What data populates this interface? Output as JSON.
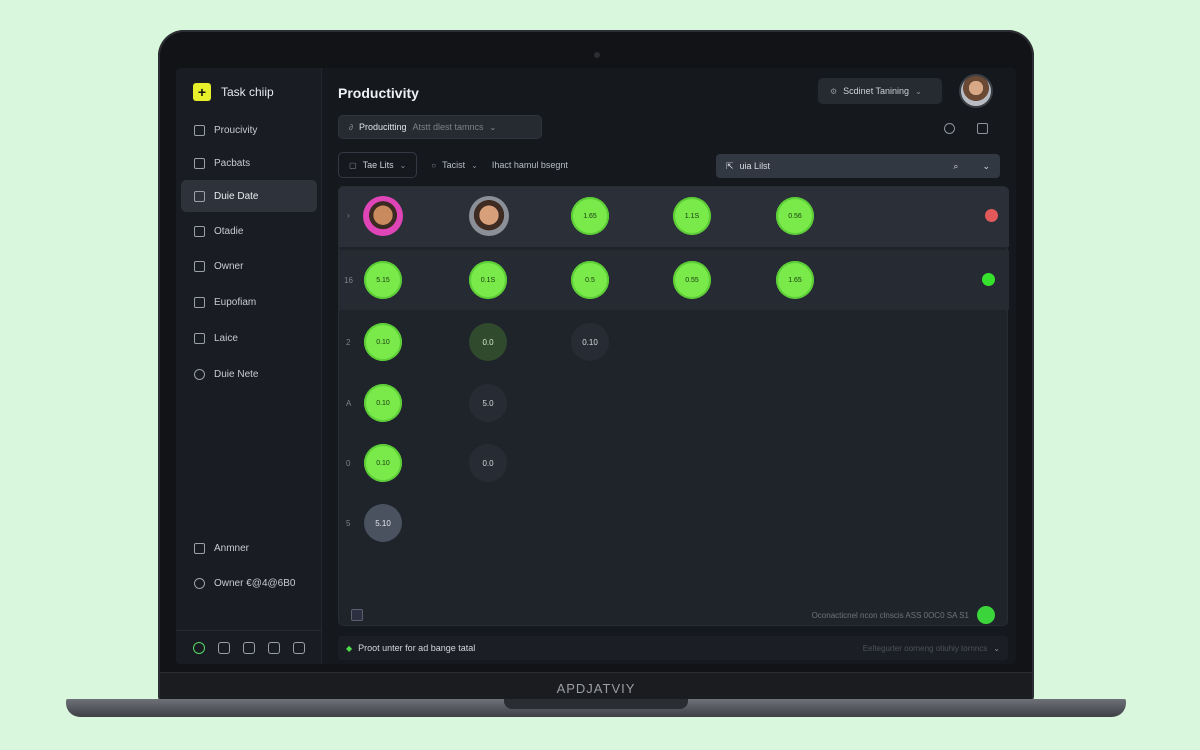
{
  "app": {
    "name": "Task chiip",
    "brand": "APDJATVIY"
  },
  "sidebar": {
    "items": [
      {
        "label": "Proucivity"
      },
      {
        "label": "Pacbats"
      },
      {
        "label": "Duie Date"
      },
      {
        "label": "Otadie"
      },
      {
        "label": "Owner"
      },
      {
        "label": "Eupofiam"
      },
      {
        "label": "Laice"
      },
      {
        "label": "Duie Nete"
      }
    ],
    "footer_items": [
      {
        "label": "Anmner"
      },
      {
        "label": "Owner €@4@6B0"
      }
    ]
  },
  "header": {
    "title": "Productivity",
    "top_select": "Scdinet Tanining",
    "chip_label": "Producitting",
    "chip_sub": "Atstt dlest tamncs"
  },
  "filters": {
    "task_list": "Tae Lits",
    "task_list_2": "Tacist",
    "search_hint": "Ihact hamul bsegnt",
    "list_search": "uia Lilst"
  },
  "board": {
    "rows": [
      {
        "label": "",
        "cells": [
          "",
          "",
          "1.65",
          "1.1S",
          "0.56"
        ]
      },
      {
        "label": "16",
        "cells": [
          "5.15",
          "0.1S",
          "0.5",
          "0.55",
          "1.65"
        ]
      },
      {
        "label": "2",
        "cells": [
          "0.10",
          "0.0",
          "0.10"
        ]
      },
      {
        "label": "A",
        "cells": [
          "0.10",
          "5.0"
        ]
      },
      {
        "label": "0",
        "cells": [
          "0.10",
          "0.0"
        ]
      },
      {
        "label": "5",
        "cells": [
          "5.10"
        ]
      }
    ],
    "footer_text": "Oconacticnel ncon clnscis ASS 0OC0 SA S1"
  },
  "status": {
    "text": "Proot unter for ad bange tatal",
    "right": "Eeltegurter oorneng otiuhiy tornncs"
  },
  "colors": {
    "accent_green": "#79ea4a",
    "status_red": "#e2595b",
    "status_green": "#36e22e",
    "logo_yellow": "#e6ef2a",
    "background": "#d9f7dc"
  }
}
